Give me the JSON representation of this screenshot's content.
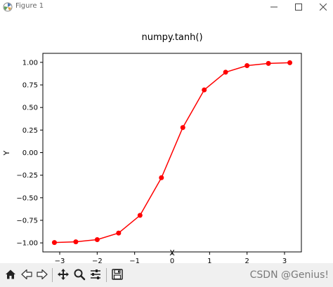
{
  "window": {
    "title": "Figure 1",
    "minimize_icon": "minimize-icon",
    "maximize_icon": "maximize-icon",
    "close_icon": "close-icon"
  },
  "toolbar": {
    "buttons": [
      {
        "name": "home-button",
        "icon": "home-icon"
      },
      {
        "name": "back-button",
        "icon": "arrow-left-icon"
      },
      {
        "name": "forward-button",
        "icon": "arrow-right-icon"
      },
      {
        "name": "pan-button",
        "icon": "move-icon"
      },
      {
        "name": "zoom-button",
        "icon": "magnifier-icon"
      },
      {
        "name": "subplots-button",
        "icon": "sliders-icon"
      },
      {
        "name": "save-button",
        "icon": "floppy-disk-icon"
      }
    ]
  },
  "watermark": "CSDN @Genius!",
  "chart_data": {
    "type": "line",
    "title": "numpy.tanh()",
    "xlabel": "X",
    "ylabel": "Y",
    "xlim": [
      -3.45,
      3.45
    ],
    "ylim": [
      -1.1,
      1.1
    ],
    "xticks": [
      -3,
      -2,
      -1,
      0,
      1,
      2,
      3
    ],
    "xtick_labels": [
      "−3",
      "−2",
      "−1",
      "0",
      "1",
      "2",
      "3"
    ],
    "yticks": [
      -1.0,
      -0.75,
      -0.5,
      -0.25,
      0.0,
      0.25,
      0.5,
      0.75,
      1.0
    ],
    "ytick_labels": [
      "−1.00",
      "−0.75",
      "−0.50",
      "−0.25",
      "0.00",
      "0.25",
      "0.50",
      "0.75",
      "1.00"
    ],
    "grid": false,
    "color": "#ff0000",
    "marker": "circle",
    "series": [
      {
        "x": [
          -3.1416,
          -2.5703,
          -1.9992,
          -1.428,
          -0.8568,
          -0.2856,
          0.2856,
          0.8568,
          1.428,
          1.9992,
          2.5703,
          3.1416
        ],
        "y": [
          -0.996,
          -0.988,
          -0.964,
          -0.891,
          -0.695,
          -0.278,
          0.278,
          0.695,
          0.891,
          0.964,
          0.988,
          0.996
        ]
      }
    ]
  }
}
